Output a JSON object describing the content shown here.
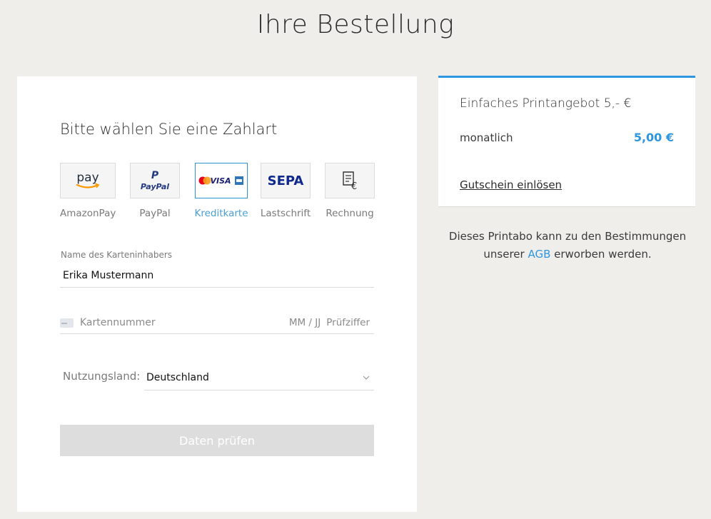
{
  "page_title": "Ihre Bestellung",
  "payment": {
    "heading": "Bitte wählen Sie eine Zahlart",
    "methods": [
      {
        "label": "AmazonPay",
        "icon": "amazon-pay-logo",
        "selected": false
      },
      {
        "label": "PayPal",
        "icon": "paypal-logo",
        "selected": false
      },
      {
        "label": "Kreditkarte",
        "icon": "credit-card-brands-logo",
        "selected": true
      },
      {
        "label": "Lastschrift",
        "icon": "sepa-logo",
        "selected": false
      },
      {
        "label": "Rechnung",
        "icon": "invoice-icon",
        "selected": false
      }
    ],
    "cardholder": {
      "label": "Name des Karteninhabers",
      "value": "Erika Mustermann"
    },
    "card": {
      "number_placeholder": "Kartennummer",
      "expiry_placeholder": "MM / JJ",
      "cvc_placeholder": "Prüfziffer"
    },
    "country": {
      "label": "Nutzungsland:",
      "value": "Deutschland"
    },
    "submit_label": "Daten prüfen"
  },
  "logos": {
    "amazon": "pay",
    "paypal": "PayPal",
    "visa": "VISA",
    "sepa": "SEPA",
    "currency": "€"
  },
  "summary": {
    "offer_title": "Einfaches Printangebot 5,- €",
    "period_label": "monatlich",
    "price": "5,00 €",
    "voucher_link": "Gutschein einlösen"
  },
  "terms": {
    "before": "Dieses Printabo kann zu den Bestimmungen unserer ",
    "link": "AGB",
    "after": " erworben werden."
  },
  "colors": {
    "accent": "#2e95e0",
    "background": "#f0eeeb",
    "button_disabled": "#dddddd"
  }
}
